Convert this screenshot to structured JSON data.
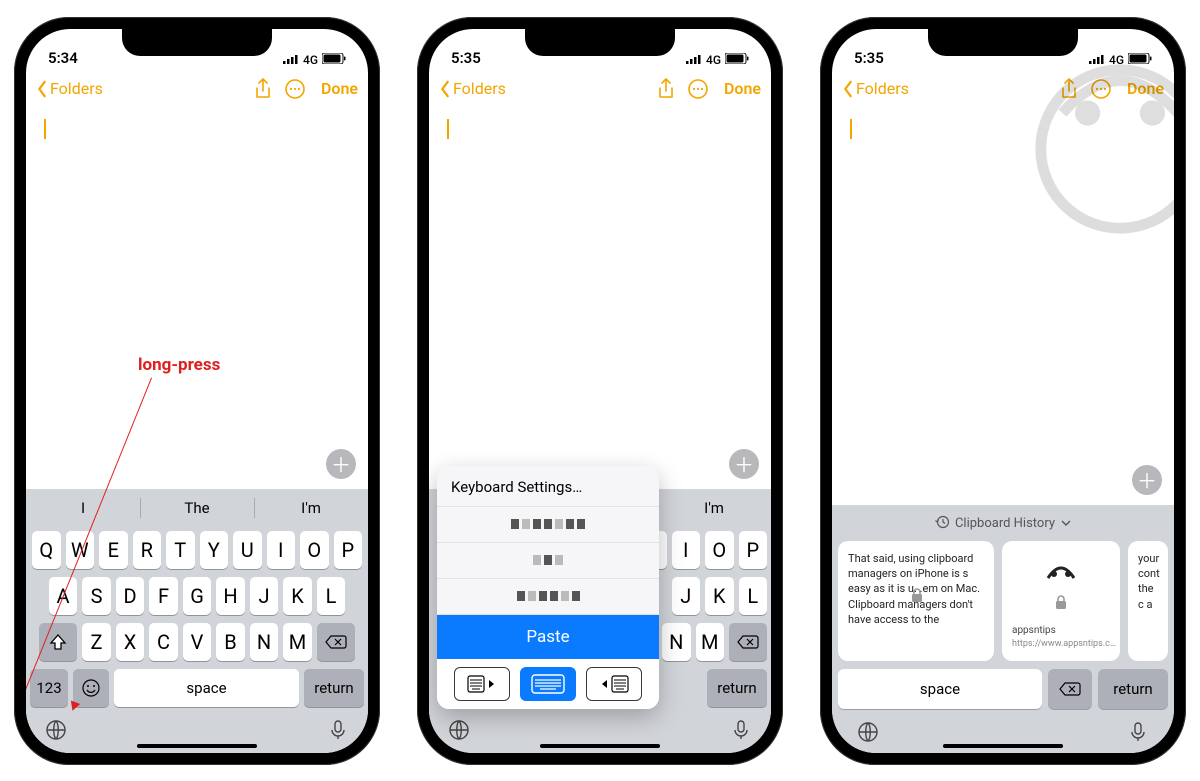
{
  "status": {
    "time1": "5:34",
    "time2": "5:35",
    "time3": "5:35",
    "net": "4G"
  },
  "nav": {
    "back": "Folders",
    "done": "Done"
  },
  "suggest": {
    "a": "I",
    "b": "The",
    "c": "I'm"
  },
  "keys": {
    "r1": [
      "Q",
      "W",
      "E",
      "R",
      "T",
      "Y",
      "U",
      "I",
      "O",
      "P"
    ],
    "r2": [
      "A",
      "S",
      "D",
      "F",
      "G",
      "H",
      "J",
      "K",
      "L"
    ],
    "r3": [
      "Z",
      "X",
      "C",
      "V",
      "B",
      "N",
      "M"
    ],
    "n123": "123",
    "space": "space",
    "ret": "return"
  },
  "p2keys": {
    "r1": [
      "U",
      "I",
      "O",
      "P"
    ],
    "r2": [
      "J",
      "K",
      "L"
    ],
    "r3": [
      "N",
      "M"
    ]
  },
  "popup": {
    "head": "Keyboard Settings…",
    "paste": "Paste"
  },
  "clip": {
    "head": "Clipboard History",
    "card1": "That said, using clipboard managers on iPhone is       s easy as it is u.       .em on Mac. Clipboard managers don't have access to the",
    "card2_src": "appsntips",
    "card2_url": "https://www.appsntips.c…",
    "card3": "your cont the c a",
    "space": "space",
    "ret": "return"
  },
  "annotation": {
    "label": "long-press"
  }
}
